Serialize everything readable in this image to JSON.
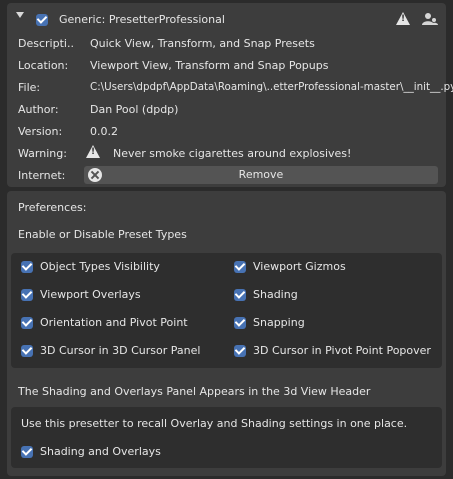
{
  "addon": {
    "header_title": "Generic: PresetterProfessional",
    "enabled": true,
    "rows": [
      {
        "label": "Descripti..",
        "value": "Quick View, Transform, and Snap Presets"
      },
      {
        "label": "Location:",
        "value": "Viewport View, Transform and Snap Popups"
      },
      {
        "label": "File:",
        "value": "C:\\Users\\dpdpf\\AppData\\Roaming\\..etterProfessional-master\\__init__.py"
      },
      {
        "label": "Author:",
        "value": "Dan Pool (dpdp)"
      },
      {
        "label": "Version:",
        "value": "0.0.2"
      },
      {
        "label": "Warning:",
        "value": "Never smoke cigarettes around explosives!"
      },
      {
        "label": "Internet:",
        "value": ""
      }
    ],
    "remove_label": "Remove",
    "icons": [
      "expand-triangle-icon",
      "warning-icon",
      "user-community-icon",
      "x-circle-icon"
    ]
  },
  "preferences": {
    "heading": "Preferences:",
    "enable_label": "Enable or Disable Preset Types",
    "types": [
      {
        "label": "Object Types Visibility",
        "checked": true
      },
      {
        "label": "Viewport Gizmos",
        "checked": true
      },
      {
        "label": "Viewport Overlays",
        "checked": true
      },
      {
        "label": "Shading",
        "checked": true
      },
      {
        "label": "Orientation and Pivot Point",
        "checked": true
      },
      {
        "label": "Snapping",
        "checked": true
      },
      {
        "label": "3D Cursor in 3D Cursor Panel",
        "checked": true
      },
      {
        "label": "3D Cursor in Pivot Point Popover",
        "checked": true
      }
    ],
    "shading_note": "The Shading and Overlays Panel Appears in the 3d View Header",
    "info_text": "Use this presetter to recall Overlay and Shading settings in one place.",
    "shading_overlays": {
      "label": "Shading and Overlays",
      "checked": true
    }
  },
  "colors": {
    "accent": "#4772b3",
    "panel": "#3d3d3d",
    "background": "#2b2b2b"
  }
}
